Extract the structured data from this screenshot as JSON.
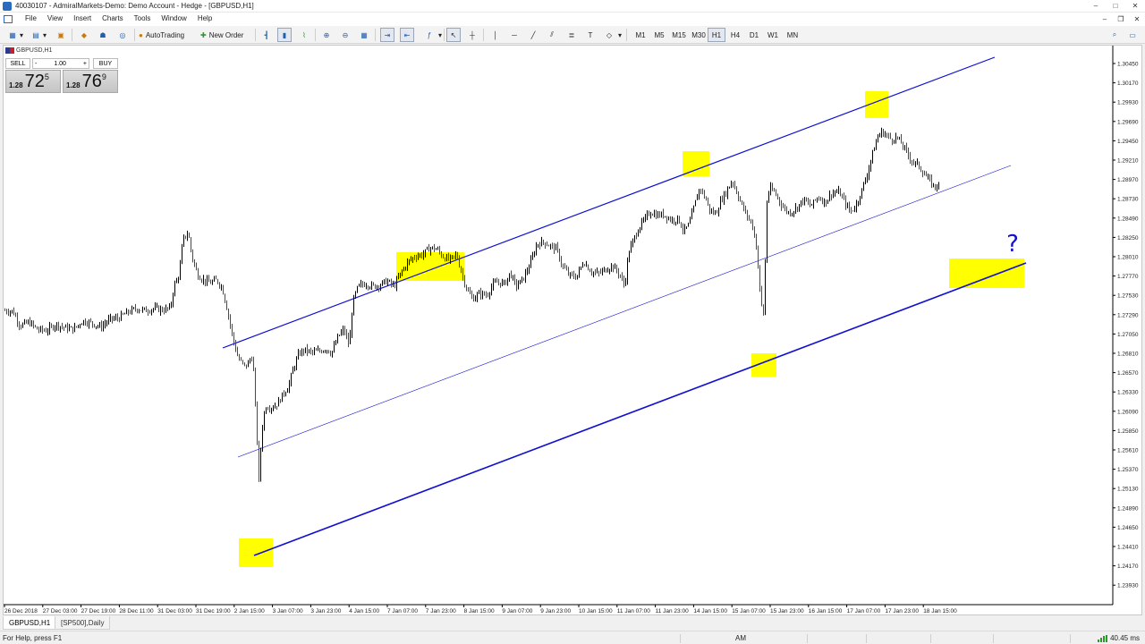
{
  "window": {
    "title": "40030107 - AdmiralMarkets-Demo: Demo Account - Hedge - [GBPUSD,H1]",
    "controls": [
      "–",
      "□",
      "✕"
    ]
  },
  "menu": {
    "items": [
      "File",
      "View",
      "Insert",
      "Charts",
      "Tools",
      "Window",
      "Help"
    ],
    "mdi_controls": [
      "–",
      "❐",
      "✕"
    ]
  },
  "toolbar": {
    "autotrading_label": "AutoTrading",
    "new_order_label": "New Order",
    "timeframes": [
      "M1",
      "M5",
      "M15",
      "M30",
      "H1",
      "H4",
      "D1",
      "W1",
      "MN"
    ],
    "active_timeframe": "H1"
  },
  "chart": {
    "symbol_label": "GBPUSD,H1",
    "one_click": {
      "sell_label": "SELL",
      "buy_label": "BUY",
      "lot_value": "1.00",
      "lot_minus": "-",
      "lot_plus": "+",
      "bid_prefix": "1.28",
      "bid_big": "72",
      "bid_sup": "5",
      "ask_prefix": "1.28",
      "ask_big": "76",
      "ask_sup": "9"
    },
    "annotation_text": "?",
    "colors": {
      "channel": "#1010d0",
      "highlight": "#ffff00",
      "candles": "#000000",
      "bear_candle": "#d01010",
      "annotation": "#1010d0"
    }
  },
  "chart_data": {
    "type": "candlestick",
    "symbol": "GBPUSD",
    "timeframe": "H1",
    "y_ticks": [
      "1.30450",
      "1.30170",
      "1.29930",
      "1.29690",
      "1.29450",
      "1.29210",
      "1.28970",
      "1.28730",
      "1.28490",
      "1.28250",
      "1.28010",
      "1.27770",
      "1.27530",
      "1.27290",
      "1.27050",
      "1.26810",
      "1.26570",
      "1.26330",
      "1.26090",
      "1.25850",
      "1.25610",
      "1.25370",
      "1.25130",
      "1.24890",
      "1.24650",
      "1.24410",
      "1.24170",
      "1.23930"
    ],
    "x_ticks": [
      "26 Dec 2018",
      "27 Dec 03:00",
      "27 Dec 19:00",
      "28 Dec 11:00",
      "31 Dec 03:00",
      "31 Dec 19:00",
      "2 Jan 15:00",
      "3 Jan 07:00",
      "3 Jan 23:00",
      "4 Jan 15:00",
      "7 Jan 07:00",
      "7 Jan 23:00",
      "8 Jan 15:00",
      "9 Jan 07:00",
      "9 Jan 23:00",
      "10 Jan 15:00",
      "11 Jan 07:00",
      "11 Jan 23:00",
      "14 Jan 15:00",
      "15 Jan 07:00",
      "15 Jan 23:00",
      "16 Jan 15:00",
      "17 Jan 07:00",
      "17 Jan 23:00",
      "18 Jan 15:00"
    ],
    "grid": false,
    "channel_lines": 3,
    "highlight_boxes": 6,
    "close_path": [
      [
        0,
        1.2687
      ],
      [
        10,
        1.2686
      ],
      [
        18,
        1.2665
      ],
      [
        28,
        1.267
      ],
      [
        38,
        1.2659
      ],
      [
        48,
        1.2658
      ],
      [
        58,
        1.2667
      ],
      [
        68,
        1.2662
      ],
      [
        78,
        1.266
      ],
      [
        88,
        1.2672
      ],
      [
        98,
        1.2669
      ],
      [
        108,
        1.2663
      ],
      [
        118,
        1.2674
      ],
      [
        128,
        1.2676
      ],
      [
        138,
        1.2684
      ],
      [
        148,
        1.269
      ],
      [
        158,
        1.2687
      ],
      [
        168,
        1.269
      ],
      [
        178,
        1.2688
      ],
      [
        186,
        1.269
      ],
      [
        190,
        1.2722
      ],
      [
        196,
        1.274
      ],
      [
        200,
        1.279
      ],
      [
        206,
        1.28
      ],
      [
        210,
        1.2766
      ],
      [
        216,
        1.274
      ],
      [
        222,
        1.2732
      ],
      [
        230,
        1.2727
      ],
      [
        238,
        1.2731
      ],
      [
        244,
        1.272
      ],
      [
        250,
        1.2686
      ],
      [
        256,
        1.2646
      ],
      [
        262,
        1.2617
      ],
      [
        270,
        1.2605
      ],
      [
        278,
        1.2622
      ],
      [
        282,
        1.2525
      ],
      [
        285,
        1.244
      ],
      [
        288,
        1.251
      ],
      [
        292,
        1.2548
      ],
      [
        300,
        1.2547
      ],
      [
        306,
        1.2552
      ],
      [
        312,
        1.2566
      ],
      [
        318,
        1.2577
      ],
      [
        324,
        1.2605
      ],
      [
        330,
        1.2625
      ],
      [
        336,
        1.263
      ],
      [
        344,
        1.2626
      ],
      [
        352,
        1.2628
      ],
      [
        360,
        1.2632
      ],
      [
        366,
        1.2625
      ],
      [
        374,
        1.265
      ],
      [
        380,
        1.266
      ],
      [
        386,
        1.2635
      ],
      [
        390,
        1.27
      ],
      [
        396,
        1.2722
      ],
      [
        404,
        1.2726
      ],
      [
        412,
        1.2722
      ],
      [
        420,
        1.2724
      ],
      [
        428,
        1.273
      ],
      [
        436,
        1.2722
      ],
      [
        444,
        1.2742
      ],
      [
        452,
        1.2758
      ],
      [
        460,
        1.2766
      ],
      [
        468,
        1.2768
      ],
      [
        476,
        1.2778
      ],
      [
        484,
        1.2776
      ],
      [
        490,
        1.2766
      ],
      [
        498,
        1.276
      ],
      [
        506,
        1.2768
      ],
      [
        512,
        1.274
      ],
      [
        518,
        1.2716
      ],
      [
        524,
        1.2704
      ],
      [
        532,
        1.2712
      ],
      [
        540,
        1.2709
      ],
      [
        546,
        1.2724
      ],
      [
        552,
        1.2728
      ],
      [
        560,
        1.2726
      ],
      [
        566,
        1.2742
      ],
      [
        572,
        1.2722
      ],
      [
        580,
        1.2732
      ],
      [
        588,
        1.2754
      ],
      [
        596,
        1.2784
      ],
      [
        604,
        1.2786
      ],
      [
        610,
        1.2781
      ],
      [
        618,
        1.2776
      ],
      [
        624,
        1.2752
      ],
      [
        632,
        1.2738
      ],
      [
        640,
        1.2736
      ],
      [
        648,
        1.2758
      ],
      [
        656,
        1.2744
      ],
      [
        664,
        1.274
      ],
      [
        672,
        1.2746
      ],
      [
        680,
        1.2752
      ],
      [
        688,
        1.274
      ],
      [
        694,
        1.2722
      ],
      [
        698,
        1.277
      ],
      [
        704,
        1.279
      ],
      [
        710,
        1.2808
      ],
      [
        716,
        1.2818
      ],
      [
        722,
        1.283
      ],
      [
        730,
        1.2825
      ],
      [
        738,
        1.2826
      ],
      [
        746,
        1.2818
      ],
      [
        754,
        1.282
      ],
      [
        760,
        1.2802
      ],
      [
        766,
        1.2812
      ],
      [
        772,
        1.284
      ],
      [
        778,
        1.2866
      ],
      [
        784,
        1.285
      ],
      [
        790,
        1.283
      ],
      [
        796,
        1.2828
      ],
      [
        802,
        1.2848
      ],
      [
        808,
        1.286
      ],
      [
        814,
        1.2876
      ],
      [
        820,
        1.2856
      ],
      [
        826,
        1.2836
      ],
      [
        832,
        1.2822
      ],
      [
        838,
        1.2806
      ],
      [
        842,
        1.277
      ],
      [
        846,
        1.27
      ],
      [
        850,
        1.2676
      ],
      [
        852,
        1.284
      ],
      [
        856,
        1.2864
      ],
      [
        862,
        1.2858
      ],
      [
        870,
        1.2838
      ],
      [
        878,
        1.2828
      ],
      [
        886,
        1.2836
      ],
      [
        894,
        1.2848
      ],
      [
        902,
        1.2838
      ],
      [
        910,
        1.2852
      ],
      [
        918,
        1.2844
      ],
      [
        926,
        1.2858
      ],
      [
        934,
        1.2858
      ],
      [
        940,
        1.2844
      ],
      [
        946,
        1.283
      ],
      [
        952,
        1.2838
      ],
      [
        958,
        1.2858
      ],
      [
        964,
        1.288
      ],
      [
        970,
        1.291
      ],
      [
        976,
        1.2936
      ],
      [
        980,
        1.2946
      ],
      [
        986,
        1.2942
      ],
      [
        992,
        1.2935
      ],
      [
        998,
        1.2938
      ],
      [
        1004,
        1.2928
      ],
      [
        1010,
        1.2914
      ],
      [
        1016,
        1.2902
      ],
      [
        1022,
        1.2898
      ],
      [
        1028,
        1.2886
      ],
      [
        1034,
        1.2876
      ],
      [
        1040,
        1.2866
      ],
      [
        1044,
        1.287
      ],
      [
        1048,
        1.2862
      ]
    ]
  },
  "tabs": [
    {
      "label": "GBPUSD,H1",
      "active": true
    },
    {
      "label": "[SP500],Daily",
      "active": false
    }
  ],
  "status": {
    "help_text": "For Help, press F1",
    "mid_text": "AM",
    "latency": "40.45 ms"
  }
}
